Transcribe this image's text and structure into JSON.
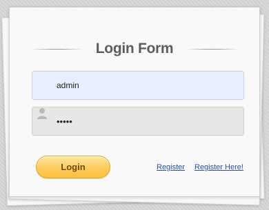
{
  "form": {
    "title": "Login Form",
    "username": {
      "value": "admin"
    },
    "password": {
      "value": "•••••",
      "icon": "user-icon"
    },
    "login_label": "Login",
    "links": {
      "register": "Register",
      "register_here": "Register Here!"
    }
  },
  "colors": {
    "username_bg": "#e8efff",
    "password_bg": "#e9e7e6",
    "button_gold": "#ffd066",
    "link_blue": "#2a4fb6"
  }
}
